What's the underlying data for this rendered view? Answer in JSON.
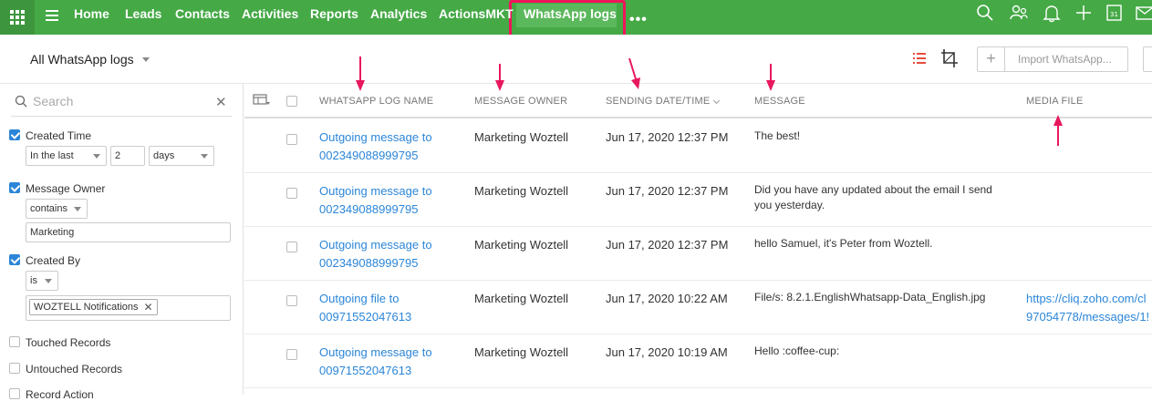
{
  "topnav": {
    "items": [
      {
        "label": "Home"
      },
      {
        "label": "Leads"
      },
      {
        "label": "Contacts"
      },
      {
        "label": "Activities"
      },
      {
        "label": "Reports"
      },
      {
        "label": "Analytics"
      },
      {
        "label": "ActionsMKT"
      },
      {
        "label": "WhatsApp logs",
        "active": true
      }
    ],
    "more": "•••",
    "colors": {
      "bar": "#45a946",
      "active_highlight": "#f0145a"
    }
  },
  "toolbar": {
    "view_name": "All WhatsApp logs",
    "import_label": "Import WhatsApp..."
  },
  "sidebar": {
    "search_placeholder": "Search",
    "filters": [
      {
        "label": "Created Time",
        "checked": true,
        "operator": "In the last",
        "value": "2",
        "unit": "days"
      },
      {
        "label": "Message Owner",
        "checked": true,
        "operator": "contains",
        "value": "Marketing"
      },
      {
        "label": "Created By",
        "checked": true,
        "operator": "is",
        "chip": "WOZTELL Notifications"
      },
      {
        "label": "Touched Records",
        "checked": false
      },
      {
        "label": "Untouched Records",
        "checked": false
      },
      {
        "label": "Record Action",
        "checked": false
      }
    ]
  },
  "table": {
    "columns": [
      "WHATSAPP LOG NAME",
      "MESSAGE OWNER",
      "SENDING DATE/TIME",
      "MESSAGE",
      "MEDIA FILE"
    ],
    "rows": [
      {
        "name1": "Outgoing message to",
        "name2": "002349088999795",
        "owner": "Marketing Woztell",
        "date": "Jun 17, 2020 12:37 PM",
        "message": "The best!",
        "media1": "",
        "media2": ""
      },
      {
        "name1": "Outgoing message to",
        "name2": "002349088999795",
        "owner": "Marketing Woztell",
        "date": "Jun 17, 2020 12:37 PM",
        "message": "Did you have any updated about the email I send you yesterday.",
        "media1": "",
        "media2": ""
      },
      {
        "name1": "Outgoing message to",
        "name2": "002349088999795",
        "owner": "Marketing Woztell",
        "date": "Jun 17, 2020 12:37 PM",
        "message": "hello Samuel, it's Peter from Woztell.",
        "media1": "",
        "media2": ""
      },
      {
        "name1": "Outgoing file to",
        "name2": "00971552047613",
        "owner": "Marketing Woztell",
        "date": "Jun 17, 2020 10:22 AM",
        "message": "File/s: 8.2.1.EnglishWhatsapp-Data_English.jpg",
        "media1": "https://cliq.zoho.com/cl",
        "media2": "97054778/messages/1!"
      },
      {
        "name1": "Outgoing message to",
        "name2": "00971552047613",
        "owner": "Marketing Woztell",
        "date": "Jun 17, 2020 10:19 AM",
        "message": "Hello :coffee-cup:",
        "media1": "",
        "media2": ""
      }
    ]
  },
  "annotation_color": "#e8175d"
}
